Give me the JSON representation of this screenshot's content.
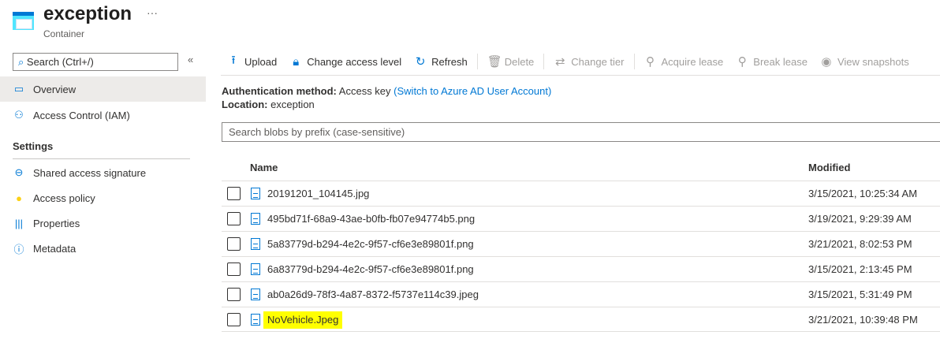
{
  "header": {
    "title": "exception",
    "subtitle": "Container",
    "more": "···"
  },
  "sidebar": {
    "search_placeholder": "Search (Ctrl+/)",
    "collapse": "«",
    "items": [
      {
        "label": "Overview"
      },
      {
        "label": "Access Control (IAM)"
      }
    ],
    "settings_heading": "Settings",
    "settings_items": [
      {
        "label": "Shared access signature"
      },
      {
        "label": "Access policy"
      },
      {
        "label": "Properties"
      },
      {
        "label": "Metadata"
      }
    ]
  },
  "toolbar": {
    "upload": "Upload",
    "change_access": "Change access level",
    "refresh": "Refresh",
    "delete": "Delete",
    "change_tier": "Change tier",
    "acquire_lease": "Acquire lease",
    "break_lease": "Break lease",
    "view_snapshots": "View snapshots"
  },
  "info": {
    "auth_label": "Authentication method:",
    "auth_value": "Access key",
    "auth_link": "(Switch to Azure AD User Account)",
    "location_label": "Location:",
    "location_value": "exception"
  },
  "blob_search_placeholder": "Search blobs by prefix (case-sensitive)",
  "table": {
    "headers": {
      "name": "Name",
      "modified": "Modified"
    },
    "rows": [
      {
        "name": "20191201_104145.jpg",
        "modified": "3/15/2021, 10:25:34 AM"
      },
      {
        "name": "495bd71f-68a9-43ae-b0fb-fb07e94774b5.png",
        "modified": "3/19/2021, 9:29:39 AM"
      },
      {
        "name": "5a83779d-b294-4e2c-9f57-cf6e3e89801f.png",
        "modified": "3/21/2021, 8:02:53 PM"
      },
      {
        "name": "6a83779d-b294-4e2c-9f57-cf6e3e89801f.png",
        "modified": "3/15/2021, 2:13:45 PM"
      },
      {
        "name": "ab0a26d9-78f3-4a87-8372-f5737e114c39.jpeg",
        "modified": "3/15/2021, 5:31:49 PM"
      },
      {
        "name": "NoVehicle.Jpeg",
        "modified": "3/21/2021, 10:39:48 PM"
      }
    ]
  }
}
